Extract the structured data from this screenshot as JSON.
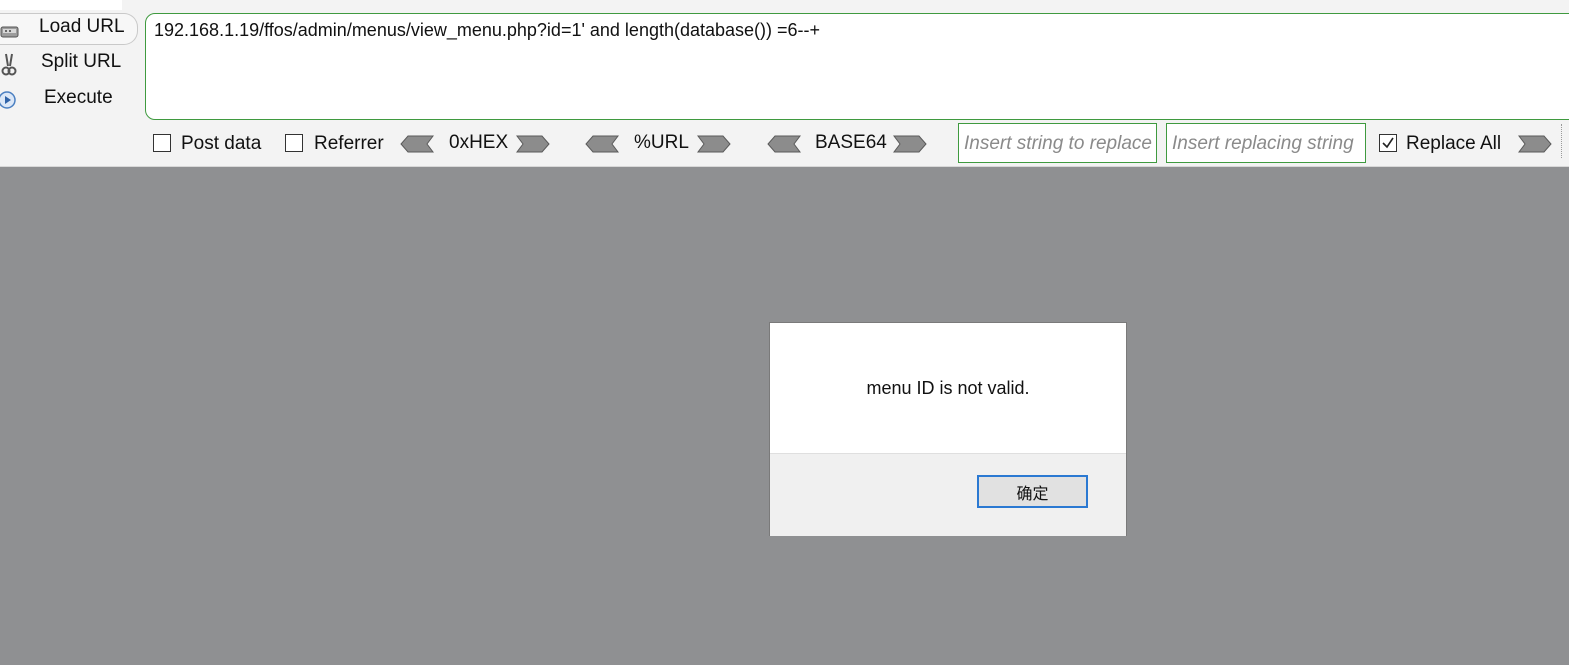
{
  "sidebar": {
    "load_url_label": "Load URL",
    "split_url_label": "Split URL",
    "execute_label": "Execute"
  },
  "url_bar": {
    "value": "192.168.1.19/ffos/admin/menus/view_menu.php?id=1' and length(database()) =6--+"
  },
  "options": {
    "post_data_label": "Post data",
    "post_data_checked": false,
    "referrer_label": "Referrer",
    "referrer_checked": false,
    "hex_label": "0xHEX",
    "url_label": "%URL",
    "base64_label": "BASE64",
    "replace_from_placeholder": "Insert string to replace",
    "replace_to_placeholder": "Insert replacing string",
    "replace_all_label": "Replace All",
    "replace_all_checked": true
  },
  "dialog": {
    "message": "menu ID is not valid.",
    "ok_label": "确定"
  },
  "colors": {
    "accent_green": "#3f9a3f",
    "page_background": "#8f9092",
    "dialog_focus_blue": "#2b79d2"
  }
}
